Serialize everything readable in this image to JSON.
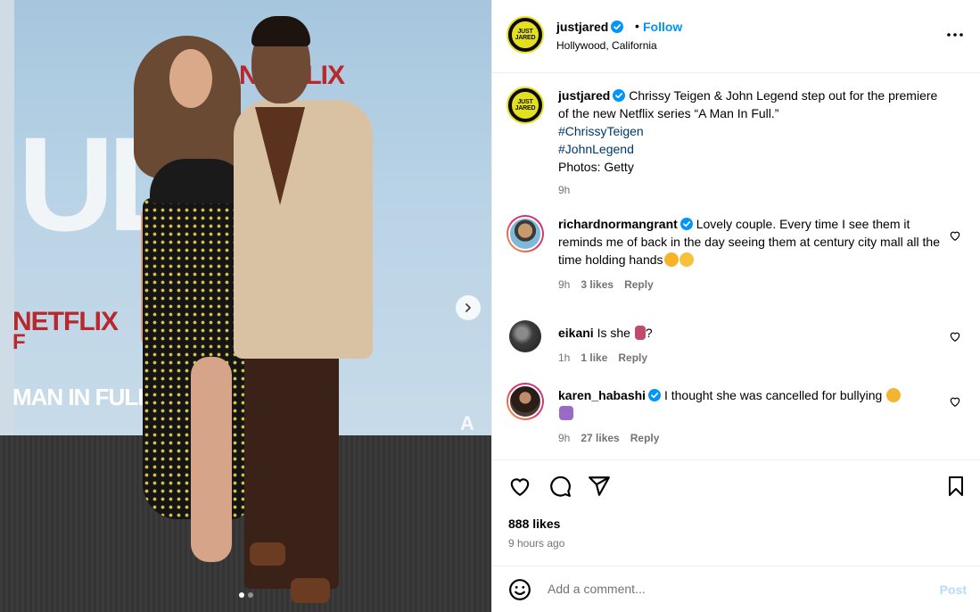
{
  "photo": {
    "bg_brand_top": "NETFLIX",
    "bg_brand_mid": "NETFLIX",
    "bg_show_title": "MAN IN FULL",
    "bg_big_letters": "ULL",
    "bg_letter_left": "F",
    "bg_letter_right": "A",
    "carousel": {
      "count": 2,
      "active": 1
    }
  },
  "header": {
    "username": "justjared",
    "separator": "•",
    "follow_label": "Follow",
    "location": "Hollywood, California",
    "avatar_text_1": "JUST",
    "avatar_text_2": "JARED"
  },
  "caption": {
    "username": "justjared",
    "text": "Chrissy Teigen & John Legend step out for the premiere of the new Netflix series “A Man In Full.”",
    "tag1": "#ChrissyTeigen",
    "tag2": "#JohnLegend",
    "credit": "Photos: Getty",
    "time": "9h"
  },
  "comments": [
    {
      "username": "richardnormangrant",
      "text": "Lovely couple. Every time I see them it reminds me of back in the day seeing them at century city mall all the time holding hands",
      "time": "9h",
      "likes": "3 likes",
      "reply": "Reply"
    },
    {
      "username": "eikani",
      "text": "Is she",
      "suffix": "?",
      "time": "1h",
      "likes": "1 like",
      "reply": "Reply"
    },
    {
      "username": "karen_habashi",
      "text": "I thought she was cancelled for bullying",
      "time": "9h",
      "likes": "27 likes",
      "reply": "Reply"
    }
  ],
  "post": {
    "likes": "888 likes",
    "ago": "9 hours ago"
  },
  "composer": {
    "placeholder": "Add a comment...",
    "post_label": "Post"
  },
  "colors": {
    "link": "#0095f6",
    "hashtag": "#00376b",
    "muted": "#737373",
    "post_disabled": "#b3dbff"
  },
  "icons": [
    "more-icon",
    "heart-icon",
    "comment-icon",
    "share-icon",
    "bookmark-icon",
    "smile-icon",
    "verified-icon",
    "chevron-right-icon"
  ]
}
